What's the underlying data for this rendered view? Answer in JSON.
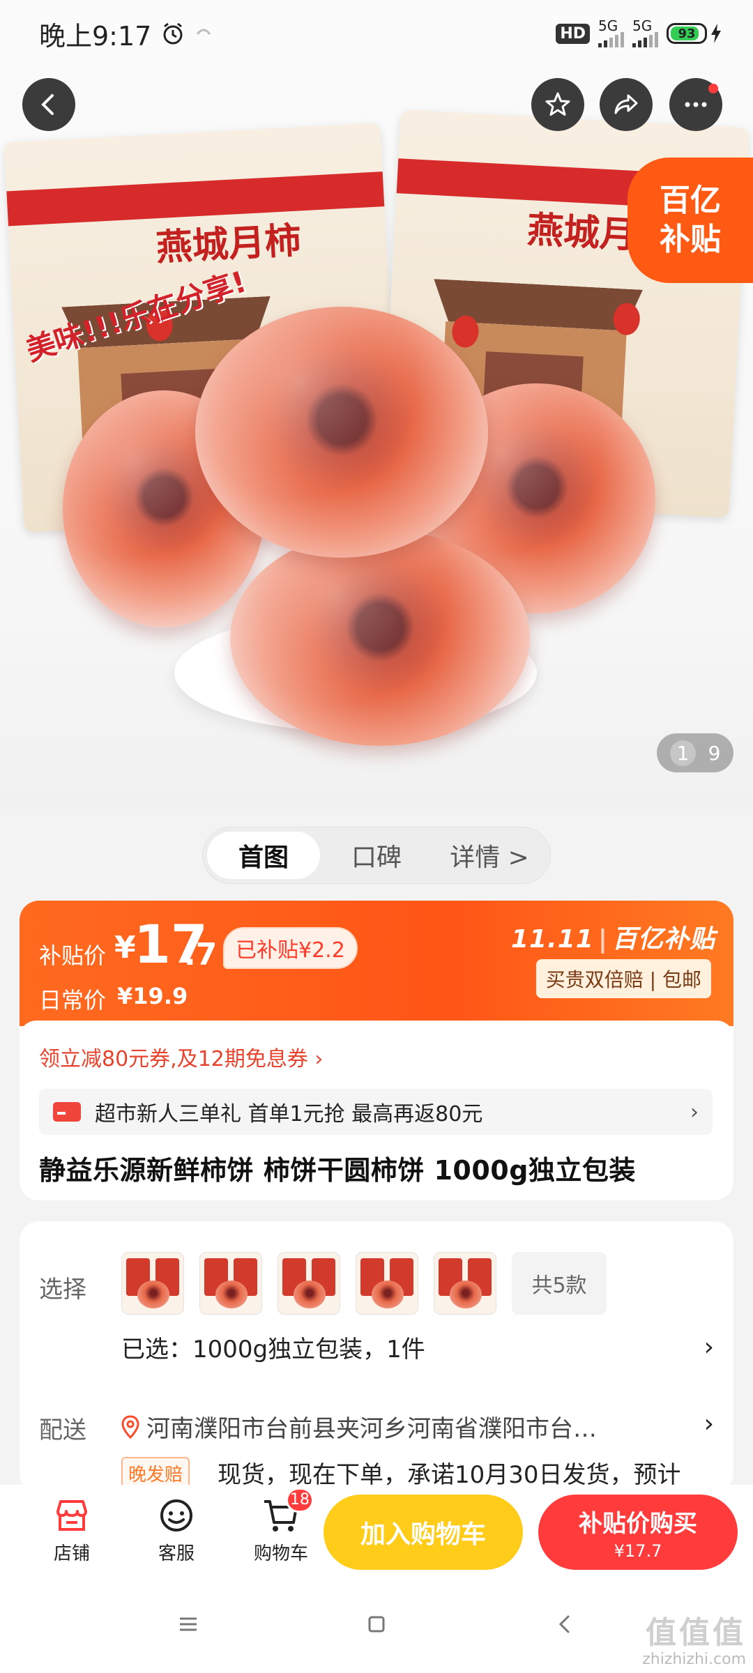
{
  "status_bar": {
    "time": "晚上9:17",
    "hd_label": "HD",
    "network_1": "5G",
    "network_2": "5G",
    "battery": "93"
  },
  "hero": {
    "pack_brand": "燕城月柿",
    "pack_tagline": "美味!!!乐在分享!",
    "subsidy_corner_line1": "百亿",
    "subsidy_corner_line2": "补贴",
    "image_index": "1",
    "image_total": "9"
  },
  "top_nav": {
    "back_icon": "chevron-left-icon",
    "favorite_icon": "star-icon",
    "share_icon": "share-icon",
    "more_icon": "more-dots-icon"
  },
  "tabs": [
    "首图",
    "口碑",
    "详情 >"
  ],
  "price": {
    "subsidy_label": "补贴价",
    "yen": "¥",
    "int": "17",
    "dec": ".7",
    "subsidized_badge": "已补贴¥2.2",
    "regular_label": "日常价",
    "regular_value": "¥19.9",
    "event_logo_left": "11.11",
    "event_logo_right": "百亿补贴",
    "service_tag": "买贵双倍赔 | 包邮"
  },
  "coupon": {
    "text": "领立减80元券,及12期免息券 ›",
    "promo_text": "超市新人三单礼  首单1元抢  最高再返80元",
    "promo_chevron": "›"
  },
  "product": {
    "title": "静益乐源新鲜柿饼 柿饼干圆柿饼 1000g独立包装"
  },
  "options": {
    "select_label": "选择",
    "more_label": "共5款",
    "selected_text": "已选：1000g独立包装，1件",
    "chevron": "›",
    "deliver_label": "配送",
    "deliver_address": "河南濮阳市台前县夹河乡河南省濮阳市台…",
    "late_badge": "晚发赔",
    "late_text": "现货，现在下单，承诺10月30日发货，预计"
  },
  "action_bar": {
    "shop_label": "店铺",
    "service_label": "客服",
    "cart_label": "购物车",
    "cart_count": "18",
    "add_cart_label": "加入购物车",
    "buy_label": "补贴价购买",
    "buy_price": "¥17.7"
  },
  "watermark": {
    "big": "值值值",
    "small": "zhizhizhi.com"
  },
  "colors": {
    "brand_orange": "#ff5a14",
    "buy_red": "#ff3b3b",
    "cart_yellow": "#ffcc1a"
  }
}
